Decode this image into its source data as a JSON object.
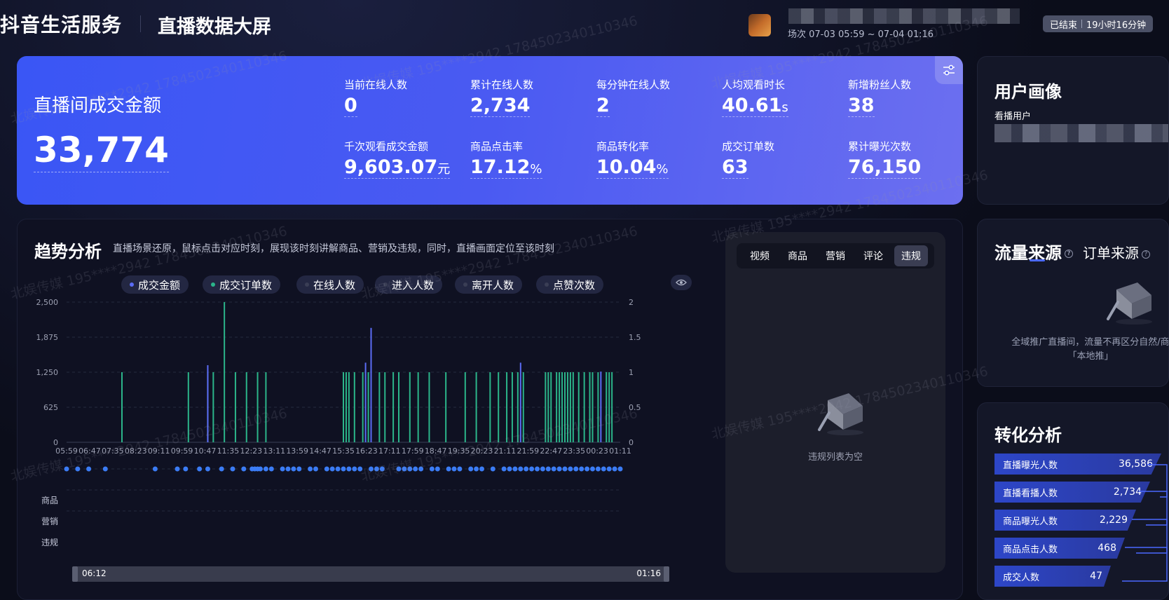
{
  "header": {
    "brand": "抖音生活服务",
    "screen_title": "直播数据大屏",
    "session": "场次 07-03 05:59 ~ 07-04 01:16",
    "status": "已结束",
    "duration": "19小时16分钟"
  },
  "kpi": {
    "main_label": "直播间成交金额",
    "main_value": "33,774",
    "items": [
      {
        "label": "当前在线人数",
        "value": "0",
        "unit": ""
      },
      {
        "label": "累计在线人数",
        "value": "2,734",
        "unit": ""
      },
      {
        "label": "每分钟在线人数",
        "value": "2",
        "unit": ""
      },
      {
        "label": "人均观看时长",
        "value": "40.61",
        "unit": "s"
      },
      {
        "label": "新增粉丝人数",
        "value": "38",
        "unit": ""
      },
      {
        "label": "千次观看成交金额",
        "value": "9,603.07",
        "unit": "元"
      },
      {
        "label": "商品点击率",
        "value": "17.12",
        "unit": "%"
      },
      {
        "label": "商品转化率",
        "value": "10.04",
        "unit": "%"
      },
      {
        "label": "成交订单数",
        "value": "63",
        "unit": ""
      },
      {
        "label": "累计曝光次数",
        "value": "76,150",
        "unit": ""
      }
    ]
  },
  "user_profile": {
    "title": "用户画像",
    "sub": "看播用户"
  },
  "traffic": {
    "tab_traffic": "流量来源",
    "tab_order": "订单来源",
    "note": "全域推广直播间，流量不再区分自然/商「本地推」"
  },
  "conversion": {
    "title": "转化分析",
    "rows": [
      {
        "label": "直播曝光人数",
        "value": "36,586"
      },
      {
        "label": "直播看播人数",
        "value": "2,734"
      },
      {
        "label": "商品曝光人数",
        "value": "2,229"
      },
      {
        "label": "商品点击人数",
        "value": "468"
      },
      {
        "label": "成交人数",
        "value": "47"
      }
    ]
  },
  "trend": {
    "title": "趋势分析",
    "desc": "直播场景还原，鼠标点击对应时刻，展现该时刻讲解商品、营销及违规，同时，直播画面定位至该时刻",
    "legend": [
      {
        "label": "成交金额",
        "color": "#5b6cf5"
      },
      {
        "label": "成交订单数",
        "color": "#2bb58a"
      },
      {
        "label": "在线人数",
        "color": "#3a3e55"
      },
      {
        "label": "进入人数",
        "color": "#3a3e55"
      },
      {
        "label": "离开人数",
        "color": "#3a3e55"
      },
      {
        "label": "点赞次数",
        "color": "#3a3e55"
      }
    ],
    "row_labels": [
      "商品",
      "营销",
      "违规"
    ],
    "timeline": {
      "start": "06:12",
      "end": "01:16"
    }
  },
  "violation": {
    "tabs": [
      "视频",
      "商品",
      "营销",
      "评论",
      "违规"
    ],
    "active_tab": "违规",
    "empty": "违规列表为空"
  },
  "chart_data": {
    "type": "bar",
    "x_ticks": [
      "05:59",
      "06:47",
      "07:35",
      "08:23",
      "09:11",
      "09:59",
      "10:47",
      "11:35",
      "12:23",
      "13:11",
      "13:59",
      "14:47",
      "15:35",
      "16:23",
      "17:11",
      "17:59",
      "18:47",
      "19:35",
      "20:23",
      "21:11",
      "21:59",
      "22:47",
      "23:35",
      "00:23",
      "01:11"
    ],
    "y_left_ticks": [
      "0",
      "625",
      "1,250",
      "1,875",
      "2,500"
    ],
    "y_right_ticks": [
      "0",
      "0.5",
      "1",
      "1.5",
      "2"
    ],
    "ylim_left": [
      0,
      2500
    ],
    "ylim_right": [
      0,
      2
    ],
    "series": [
      {
        "name": "成交金额",
        "color": "#5b6cf5",
        "points": [
          [
            0.255,
            1375
          ],
          [
            0.55,
            2040
          ],
          [
            0.54,
            1420
          ],
          [
            0.82,
            1420
          ],
          [
            0.965,
            1260
          ]
        ]
      },
      {
        "name": "成交订单数",
        "color": "#2bb58a",
        "points": [
          [
            0.1,
            1
          ],
          [
            0.22,
            1
          ],
          [
            0.255,
            1
          ],
          [
            0.265,
            1
          ],
          [
            0.285,
            2
          ],
          [
            0.305,
            1
          ],
          [
            0.325,
            1
          ],
          [
            0.345,
            1
          ],
          [
            0.36,
            1
          ],
          [
            0.5,
            1
          ],
          [
            0.505,
            1
          ],
          [
            0.51,
            1
          ],
          [
            0.52,
            1
          ],
          [
            0.535,
            1
          ],
          [
            0.545,
            1
          ],
          [
            0.565,
            1
          ],
          [
            0.575,
            1
          ],
          [
            0.59,
            1
          ],
          [
            0.6,
            1
          ],
          [
            0.62,
            1
          ],
          [
            0.635,
            1
          ],
          [
            0.655,
            1
          ],
          [
            0.685,
            1
          ],
          [
            0.72,
            1
          ],
          [
            0.74,
            1
          ],
          [
            0.765,
            1
          ],
          [
            0.78,
            1
          ],
          [
            0.795,
            1
          ],
          [
            0.805,
            1
          ],
          [
            0.815,
            1
          ],
          [
            0.825,
            1
          ],
          [
            0.865,
            1
          ],
          [
            0.87,
            1
          ],
          [
            0.875,
            1
          ],
          [
            0.885,
            1
          ],
          [
            0.89,
            1
          ],
          [
            0.895,
            1
          ],
          [
            0.9,
            1
          ],
          [
            0.905,
            1
          ],
          [
            0.91,
            1
          ],
          [
            0.915,
            1
          ],
          [
            0.925,
            1
          ],
          [
            0.935,
            1
          ],
          [
            0.945,
            1
          ],
          [
            0.95,
            1
          ],
          [
            0.96,
            1
          ],
          [
            0.975,
            1
          ],
          [
            0.98,
            1
          ],
          [
            0.985,
            1
          ]
        ]
      }
    ],
    "product_markers": [
      0.0,
      0.02,
      0.04,
      0.07,
      0.16,
      0.2,
      0.215,
      0.24,
      0.255,
      0.28,
      0.3,
      0.32,
      0.335,
      0.34,
      0.345,
      0.35,
      0.36,
      0.37,
      0.39,
      0.4,
      0.41,
      0.42,
      0.44,
      0.45,
      0.47,
      0.48,
      0.49,
      0.5,
      0.51,
      0.52,
      0.53,
      0.55,
      0.56,
      0.57,
      0.6,
      0.61,
      0.62,
      0.63,
      0.64,
      0.66,
      0.67,
      0.69,
      0.7,
      0.71,
      0.73,
      0.74,
      0.75,
      0.77,
      0.79,
      0.8,
      0.81,
      0.82,
      0.83,
      0.84,
      0.85,
      0.86,
      0.87,
      0.88,
      0.89,
      0.9,
      0.91,
      0.92,
      0.93,
      0.94,
      0.95,
      0.96,
      0.97,
      0.98,
      0.99,
      1.0
    ]
  }
}
